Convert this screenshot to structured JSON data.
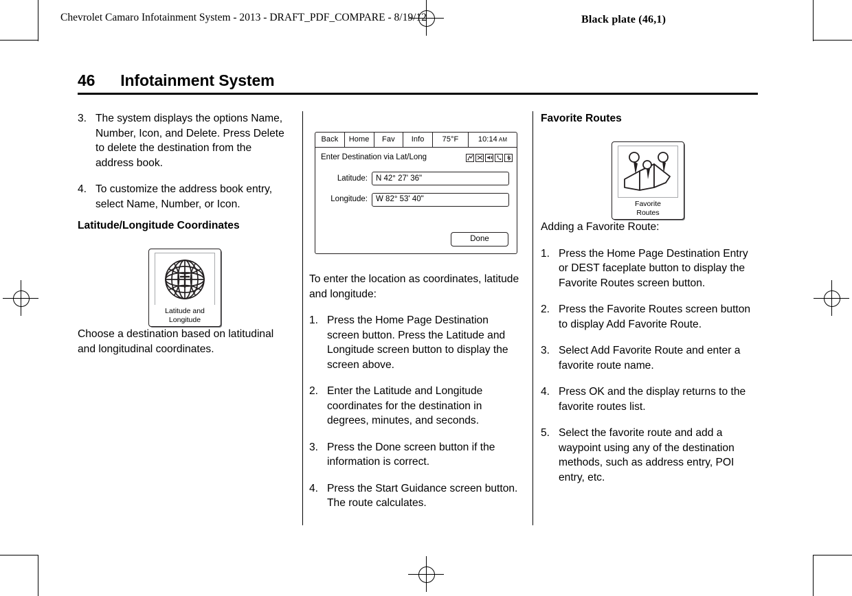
{
  "running_head": "Chevrolet Camaro Infotainment System - 2013 - DRAFT_PDF_COMPARE - 8/19/12",
  "black_plate": "Black plate (46,1)",
  "page": {
    "number": "46",
    "title": "Infotainment System"
  },
  "column1": {
    "steps": [
      {
        "num": "3.",
        "text": "The system displays the options Name, Number, Icon, and Delete. Press Delete to delete the destination from the address book."
      },
      {
        "num": "4.",
        "text": "To customize the address book entry, select Name, Number, or Icon."
      }
    ],
    "heading": "Latitude/Longitude Coordinates",
    "icon_caption_line1": "Latitude and",
    "icon_caption_line2": "Longitude",
    "icon_name": "globe-icon",
    "body": "Choose a destination based on latitudinal and longitudinal coordinates."
  },
  "column2": {
    "screen": {
      "tabs": [
        "Back",
        "Home",
        "Fav",
        "Info"
      ],
      "temperature": "75°F",
      "clock_time": "10:14",
      "clock_meridiem": "AM",
      "screen_title": "Enter Destination via Lat/Long",
      "status_icons": [
        "route-icon",
        "shuffle-icon",
        "mute-speaker-icon",
        "phone-icon",
        "bluetooth-icon"
      ],
      "fields": [
        {
          "label": "Latitude:",
          "value": "N 42° 27' 36\""
        },
        {
          "label": "Longitude:",
          "value": "W 82° 53' 40\""
        }
      ],
      "done_label": "Done"
    },
    "intro": "To enter the location as coordinates, latitude and longitude:",
    "steps": [
      {
        "num": "1.",
        "text": "Press the Home Page Destination screen button. Press the Latitude and Longitude screen button to display the screen above."
      },
      {
        "num": "2.",
        "text": "Enter the Latitude and Longitude coordinates for the destination in degrees, minutes, and seconds."
      },
      {
        "num": "3.",
        "text": "Press the Done screen button if the information is correct."
      },
      {
        "num": "4.",
        "text": "Press the Start Guidance screen button. The route calculates."
      }
    ]
  },
  "column3": {
    "heading": "Favorite Routes",
    "icon_caption_line1": "Favorite",
    "icon_caption_line2": "Routes",
    "icon_name": "favorite-routes-map-icon",
    "intro": "Adding a Favorite Route:",
    "steps": [
      {
        "num": "1.",
        "text": "Press the Home Page Destination Entry or DEST faceplate button to display the Favorite Routes screen button."
      },
      {
        "num": "2.",
        "text": "Press the Favorite Routes screen button to display Add Favorite Route."
      },
      {
        "num": "3.",
        "text": "Select Add Favorite Route and enter a favorite route name."
      },
      {
        "num": "4.",
        "text": "Press OK and the display returns to the favorite routes list."
      },
      {
        "num": "5.",
        "text": "Select the favorite route and add a waypoint using any of the destination methods, such as address entry, POI entry, etc."
      }
    ]
  }
}
